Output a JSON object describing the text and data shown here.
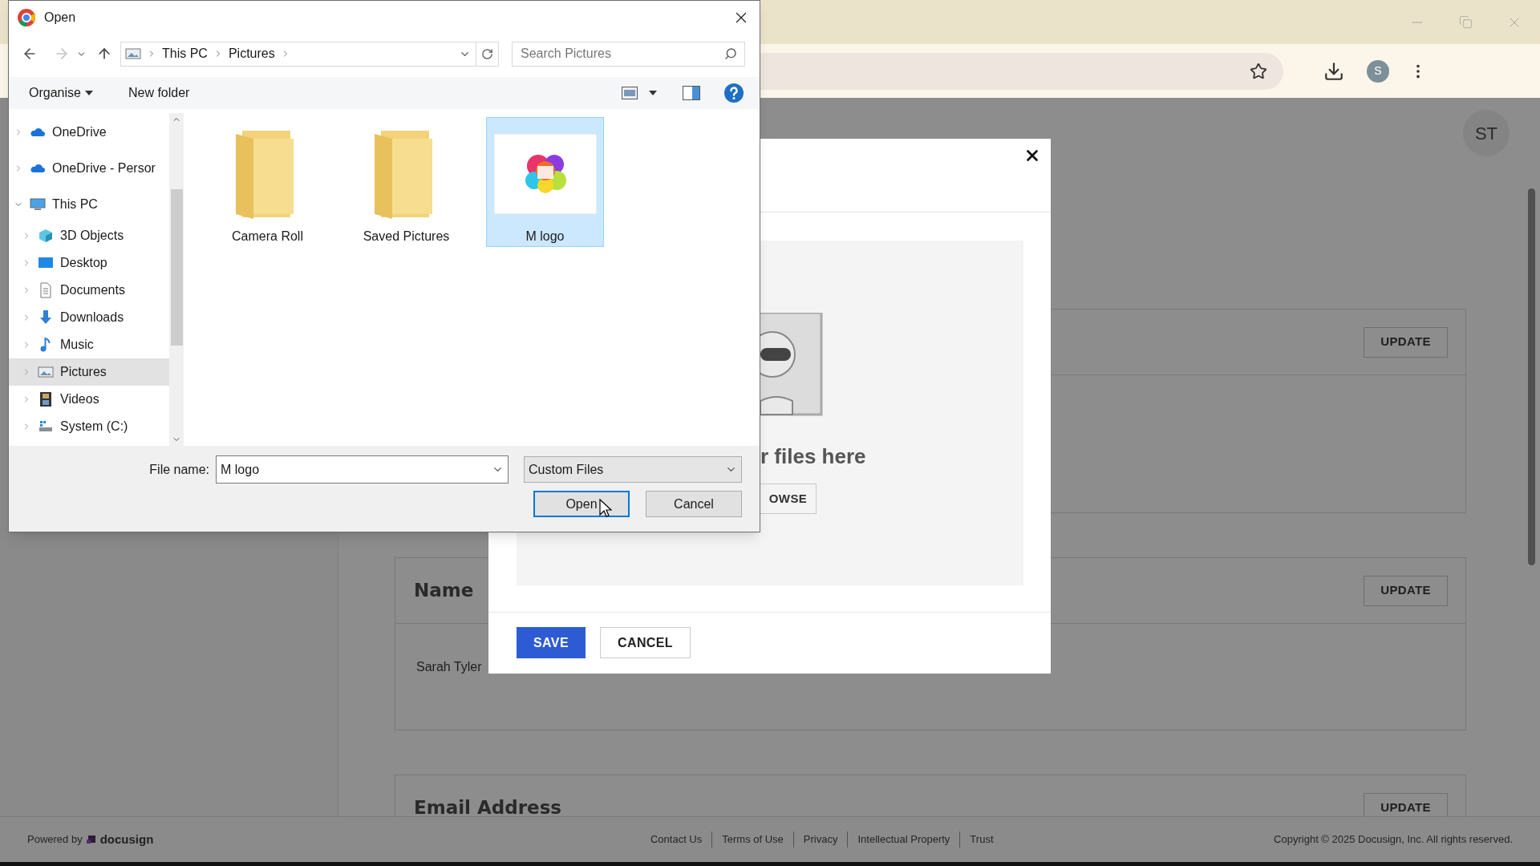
{
  "browser": {
    "profile_initial": "S"
  },
  "page": {
    "avatar": "ST",
    "sections": [
      {
        "button": "UPDATE"
      },
      {
        "title": "Name",
        "value": "Sarah Tyler",
        "button": "UPDATE"
      },
      {
        "title": "Email Address",
        "button": "UPDATE"
      }
    ],
    "footer": {
      "powered_by": "Powered by",
      "brand": "docusign",
      "links": [
        "Contact Us",
        "Terms of Use",
        "Privacy",
        "Intellectual Property",
        "Trust"
      ],
      "copyright": "Copyright © 2025 Docusign, Inc. All rights reserved."
    }
  },
  "modal": {
    "drop_text": "r files here",
    "browse_button": "OWSE",
    "buttons": [
      {
        "label": "SAVE",
        "kind": "primary"
      },
      {
        "label": "CANCEL",
        "kind": "secondary"
      }
    ]
  },
  "file_dialog": {
    "title": "Open",
    "breadcrumb": [
      "This PC",
      "Pictures"
    ],
    "search": {
      "placeholder": "Search Pictures"
    },
    "toolbar": {
      "organise": "Organise",
      "new_folder": "New folder"
    },
    "sidebar": [
      {
        "label": "OneDrive",
        "kind": "cloud",
        "expanded": false,
        "selected": false
      },
      {
        "label": "OneDrive - Persor",
        "kind": "cloud",
        "expanded": false,
        "selected": false
      },
      {
        "label": "This PC",
        "kind": "computer",
        "expanded": true,
        "selected": false,
        "children": [
          {
            "label": "3D Objects",
            "kind": "cube",
            "expanded": false,
            "selected": false
          },
          {
            "label": "Desktop",
            "kind": "desktop",
            "expanded": false,
            "selected": false
          },
          {
            "label": "Documents",
            "kind": "document",
            "expanded": false,
            "selected": false
          },
          {
            "label": "Downloads",
            "kind": "download",
            "expanded": false,
            "selected": false
          },
          {
            "label": "Music",
            "kind": "music",
            "expanded": false,
            "selected": false
          },
          {
            "label": "Pictures",
            "kind": "pictures",
            "expanded": false,
            "selected": true
          },
          {
            "label": "Videos",
            "kind": "video",
            "expanded": false,
            "selected": false
          },
          {
            "label": "System (C:)",
            "kind": "drive",
            "expanded": false,
            "selected": false
          }
        ]
      }
    ],
    "files": [
      {
        "name": "Camera Roll",
        "kind": "folder",
        "selected": false
      },
      {
        "name": "Saved Pictures",
        "kind": "folder",
        "selected": false
      },
      {
        "name": "M logo",
        "selected": true
      }
    ],
    "file_name": {
      "label": "File name:",
      "value": "M logo"
    },
    "file_type": "Custom Files",
    "buttons": [
      {
        "label": "Open",
        "kind": "default"
      },
      {
        "label": "Cancel",
        "kind": "normal"
      }
    ]
  }
}
